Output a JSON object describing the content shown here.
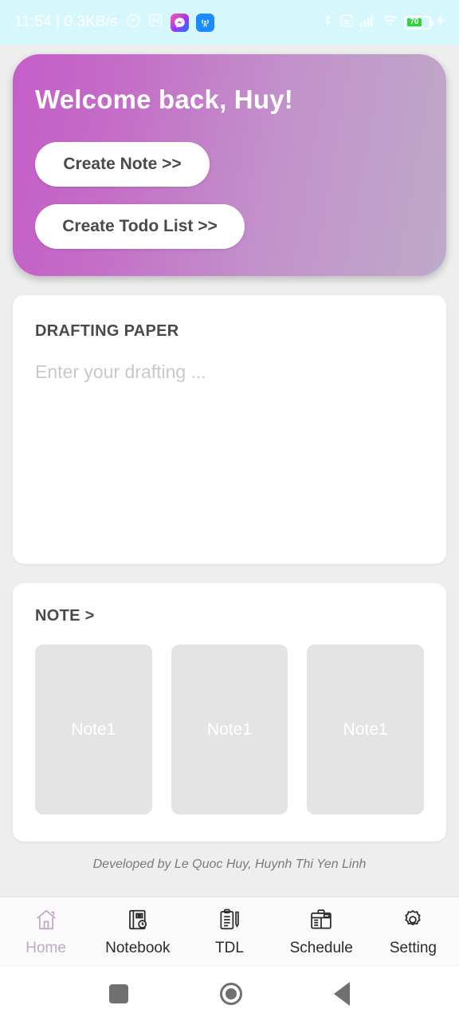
{
  "status_bar": {
    "clock_and_rate": "11:54 | 0.3KB/s",
    "battery_percent": "70",
    "icons": [
      "heart-outline-icon",
      "nfc-icon",
      "messenger-icon",
      "wifi-app-icon",
      "bluetooth-icon",
      "sim-icon",
      "signal-icon",
      "wifi-icon",
      "battery-icon"
    ]
  },
  "hero": {
    "title": "Welcome back, Huy!",
    "create_note_label": "Create Note >>",
    "create_todo_label": "Create Todo List >>",
    "gradient_from": "#c55ec8",
    "gradient_to": "#bfa9c9"
  },
  "drafting": {
    "title": "DRAFTING PAPER",
    "placeholder": "Enter your drafting ...",
    "value": ""
  },
  "notes": {
    "title": "NOTE >",
    "tiles": [
      {
        "label": "Note1"
      },
      {
        "label": "Note1"
      },
      {
        "label": "Note1"
      }
    ]
  },
  "credit": "Developed by Le Quoc Huy, Huynh Thi Yen Linh",
  "tabbar": {
    "active_color": "#c3a8c8",
    "items": [
      {
        "label": "Home",
        "icon": "home-icon",
        "active": true
      },
      {
        "label": "Notebook",
        "icon": "notebook-icon",
        "active": false
      },
      {
        "label": "TDL",
        "icon": "clipboard-pen-icon",
        "active": false
      },
      {
        "label": "Schedule",
        "icon": "schedule-icon",
        "active": false
      },
      {
        "label": "Setting",
        "icon": "gear-icon",
        "active": false
      }
    ]
  },
  "android_nav": {
    "recents": "recents-square-icon",
    "home": "home-circle-icon",
    "back": "back-triangle-icon"
  }
}
